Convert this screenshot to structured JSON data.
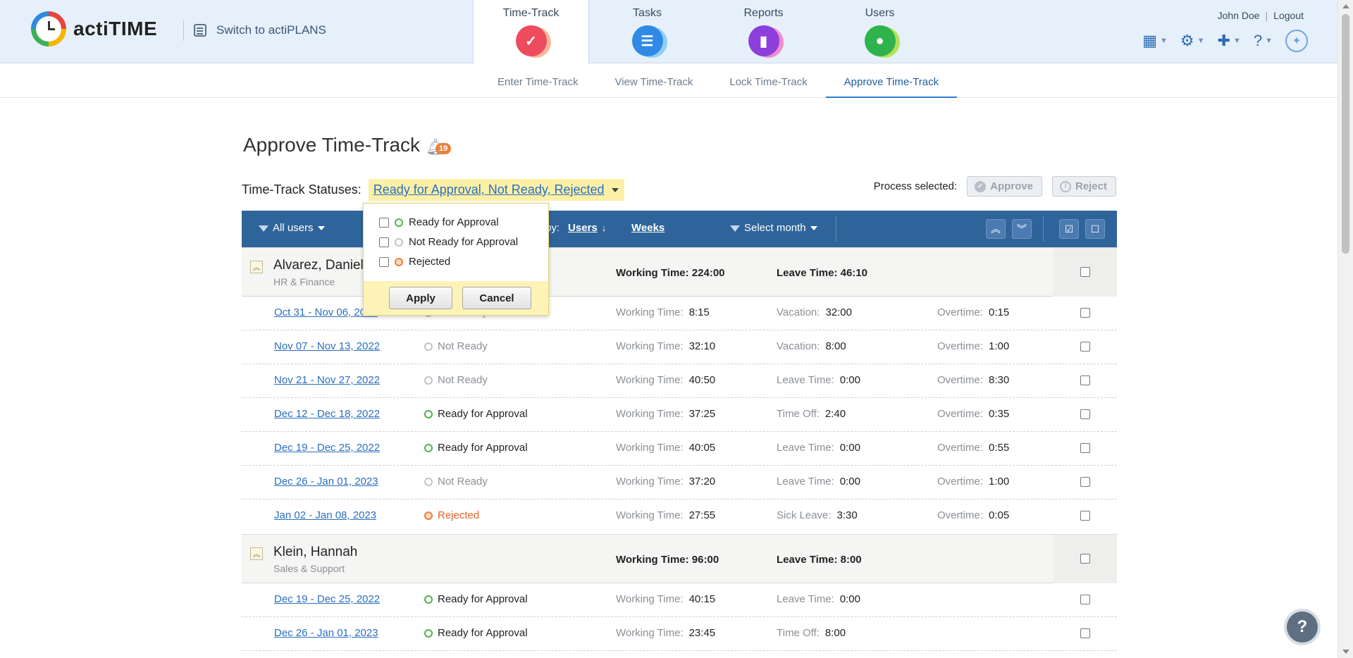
{
  "brand": {
    "name": "actiTIME",
    "switch_label": "Switch to actiPLANS"
  },
  "main_tabs": [
    {
      "label": "Time-Track",
      "color": "#ef4b5e"
    },
    {
      "label": "Tasks",
      "color": "#2f8ae6"
    },
    {
      "label": "Reports",
      "color": "#8c3fdc"
    },
    {
      "label": "Users",
      "color": "#2fb34d"
    }
  ],
  "user": {
    "name": "John Doe",
    "logout": "Logout"
  },
  "subnav": [
    "Enter Time-Track",
    "View Time-Track",
    "Lock Time-Track",
    "Approve Time-Track"
  ],
  "page": {
    "title": "Approve Time-Track",
    "notification_count": "19",
    "status_label": "Time-Track Statuses:",
    "status_value": "Ready for Approval, Not Ready, Rejected",
    "process_label": "Process selected:",
    "approve": "Approve",
    "reject": "Reject"
  },
  "toolbar": {
    "users_filter": "All users",
    "group_by_suffix": "by:",
    "group_users": "Users",
    "group_weeks": "Weeks",
    "month_filter": "Select month"
  },
  "popup": {
    "options": [
      "Ready for Approval",
      "Not Ready for Approval",
      "Rejected"
    ],
    "apply": "Apply",
    "cancel": "Cancel"
  },
  "groups": [
    {
      "name": "Alvarez, Daniel",
      "dept": "HR & Finance",
      "working": "Working Time:  224:00",
      "leave": "Leave Time:  46:10",
      "rows": [
        {
          "date": "Oct 31 - Nov 06, 2022",
          "status": "Not Ready",
          "w_label": "Working Time:",
          "w": "8:15",
          "l_label": "Vacation:",
          "l": "32:00",
          "o_label": "Overtime:",
          "o": "0:15"
        },
        {
          "date": "Nov 07 - Nov 13, 2022",
          "status": "Not Ready",
          "w_label": "Working Time:",
          "w": "32:10",
          "l_label": "Vacation:",
          "l": "8:00",
          "o_label": "Overtime:",
          "o": "1:00"
        },
        {
          "date": "Nov 21 - Nov 27, 2022",
          "status": "Not Ready",
          "w_label": "Working Time:",
          "w": "40:50",
          "l_label": "Leave Time:",
          "l": "0:00",
          "o_label": "Overtime:",
          "o": "8:30"
        },
        {
          "date": "Dec 12 - Dec 18, 2022",
          "status": "Ready for Approval",
          "w_label": "Working Time:",
          "w": "37:25",
          "l_label": "Time Off:",
          "l": "2:40",
          "o_label": "Overtime:",
          "o": "0:35"
        },
        {
          "date": "Dec 19 - Dec 25, 2022",
          "status": "Ready for Approval",
          "w_label": "Working Time:",
          "w": "40:05",
          "l_label": "Leave Time:",
          "l": "0:00",
          "o_label": "Overtime:",
          "o": "0:55"
        },
        {
          "date": "Dec 26 - Jan 01, 2023",
          "status": "Not Ready",
          "w_label": "Working Time:",
          "w": "37:20",
          "l_label": "Leave Time:",
          "l": "0:00",
          "o_label": "Overtime:",
          "o": "1:00"
        },
        {
          "date": "Jan 02 - Jan 08, 2023",
          "status": "Rejected",
          "w_label": "Working Time:",
          "w": "27:55",
          "l_label": "Sick Leave:",
          "l": "3:30",
          "o_label": "Overtime:",
          "o": "0:05"
        }
      ]
    },
    {
      "name": "Klein, Hannah",
      "dept": "Sales & Support",
      "working": "Working Time:  96:00",
      "leave": "Leave Time:  8:00",
      "rows": [
        {
          "date": "Dec 19 - Dec 25, 2022",
          "status": "Ready for Approval",
          "w_label": "Working Time:",
          "w": "40:15",
          "l_label": "Leave Time:",
          "l": "0:00"
        },
        {
          "date": "Dec 26 - Jan 01, 2023",
          "status": "Ready for Approval",
          "w_label": "Working Time:",
          "w": "23:45",
          "l_label": "Time Off:",
          "l": "8:00"
        }
      ]
    }
  ]
}
